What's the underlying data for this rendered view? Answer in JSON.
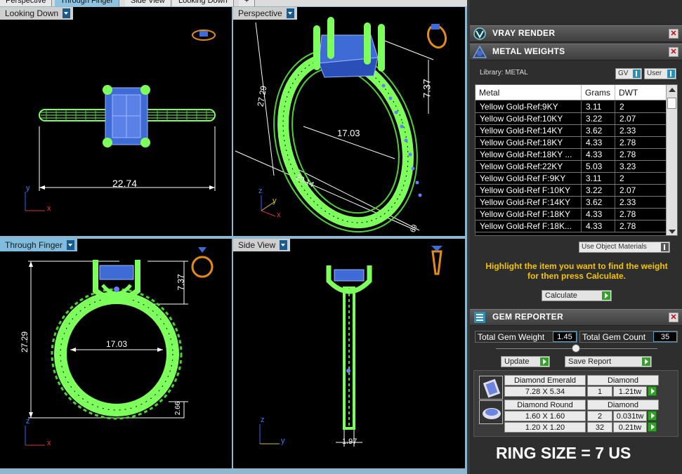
{
  "top_tabs": [
    "Perspective",
    "Through Finger",
    "Side View",
    "Looking Down",
    "+"
  ],
  "viewports": {
    "top_left": {
      "label": "Looking Down",
      "dimension": "22.74",
      "axis_y": "y",
      "axis_x": "x"
    },
    "top_right": {
      "label": "Perspective",
      "dim_a": "27.29",
      "dim_b": "7.37",
      "dim_c": "17.03",
      "dim_d": "20.14",
      "dim_e": "69",
      "axis_z": "z",
      "axis_y": "y",
      "axis_x": "x"
    },
    "bottom_left": {
      "label": "Through Finger",
      "dim_height": "27.29",
      "dim_top": "7.37",
      "dim_inner": "17.03",
      "dim_shank": "2.66",
      "axis_z": "z",
      "axis_x": "x"
    },
    "bottom_right": {
      "label": "Side View",
      "dim_width": "1.97",
      "axis_z": "z",
      "axis_y": "y"
    }
  },
  "panel": {
    "vray": {
      "title": "VRAY RENDER",
      "icon": "vray-icon"
    },
    "metal": {
      "title": "METAL WEIGHTS",
      "icon": "metal-weights-icon",
      "library_label": "Library: METAL",
      "gv_label": "GV",
      "user_label": "User",
      "columns": [
        "Metal",
        "Grams",
        "DWT"
      ],
      "rows": [
        [
          "Yellow Gold-Ref:9KY",
          "3.11",
          "2"
        ],
        [
          "Yellow Gold-Ref:10KY",
          "3.22",
          "2.07"
        ],
        [
          "Yellow Gold-Ref:14KY",
          "3.62",
          "2.33"
        ],
        [
          "Yellow Gold-Ref:18KY",
          "4.33",
          "2.78"
        ],
        [
          "Yellow Gold-Ref:18KY ...",
          "4.33",
          "2.78"
        ],
        [
          "Yellow Gold-Ref:22KY",
          "5.03",
          "3.23"
        ],
        [
          "Yellow Gold-Ref F:9KY",
          "3.11",
          "2"
        ],
        [
          "Yellow Gold-Ref F:10KY",
          "3.22",
          "2.07"
        ],
        [
          "Yellow Gold-Ref F:14KY",
          "3.62",
          "2.33"
        ],
        [
          "Yellow Gold-Ref F:18KY",
          "4.33",
          "2.78"
        ],
        [
          "Yellow Gold-Ref F:18K...",
          "4.33",
          "2.78"
        ]
      ],
      "use_object_materials": "Use Object Materials",
      "hint": "Highlight the item you want to find the weight for then press Calculate.",
      "calculate": "Calculate"
    },
    "gem": {
      "title": "GEM REPORTER",
      "icon": "gem-reporter-icon",
      "total_weight_label": "Total Gem Weight",
      "total_weight_value": "1.45",
      "total_count_label": "Total Gem Count",
      "total_count_value": "35",
      "update": "Update",
      "save_report": "Save Report",
      "groups": [
        {
          "name": "Diamond Emerald",
          "material": "Diamond",
          "rows": [
            {
              "size": "7.28 X 5.34",
              "count": "1",
              "weight": "1.21tw"
            }
          ]
        },
        {
          "name": "Diamond Round",
          "material": "Diamond",
          "rows": [
            {
              "size": "1.60 X 1.60",
              "count": "2",
              "weight": "0.031tw"
            },
            {
              "size": "1.20 X 1.20",
              "count": "32",
              "weight": "0.21tw"
            }
          ]
        }
      ]
    },
    "ring_size": "RING SIZE = 7 US"
  },
  "colors": {
    "wire_green": "#7dff5c",
    "gem_blue": "#3f6bd6",
    "accent_yellow": "#f4c400",
    "viewport_bg": "#000000"
  }
}
